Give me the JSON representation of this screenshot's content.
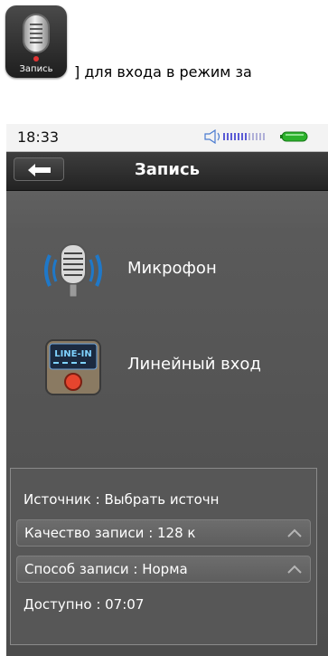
{
  "manual": {
    "app_icon_label": "Запись",
    "text": "] для входа в режим за"
  },
  "status_bar": {
    "time": "18:33"
  },
  "title_bar": {
    "title": "Запись"
  },
  "menu": [
    {
      "label": "Микрофон",
      "icon": "microphone-icon"
    },
    {
      "label": "Линейный вход",
      "icon": "line-in-icon",
      "icon_text": "LINE-IN"
    }
  ],
  "settings": {
    "source": "Источник : Выбрать источн",
    "quality": "Качество записи : 128 к",
    "method": "Способ записи : Норма",
    "available": "Доступно : 07:07"
  },
  "colors": {
    "accent_blue": "#1f78c8",
    "battery_green": "#2bb22b"
  }
}
